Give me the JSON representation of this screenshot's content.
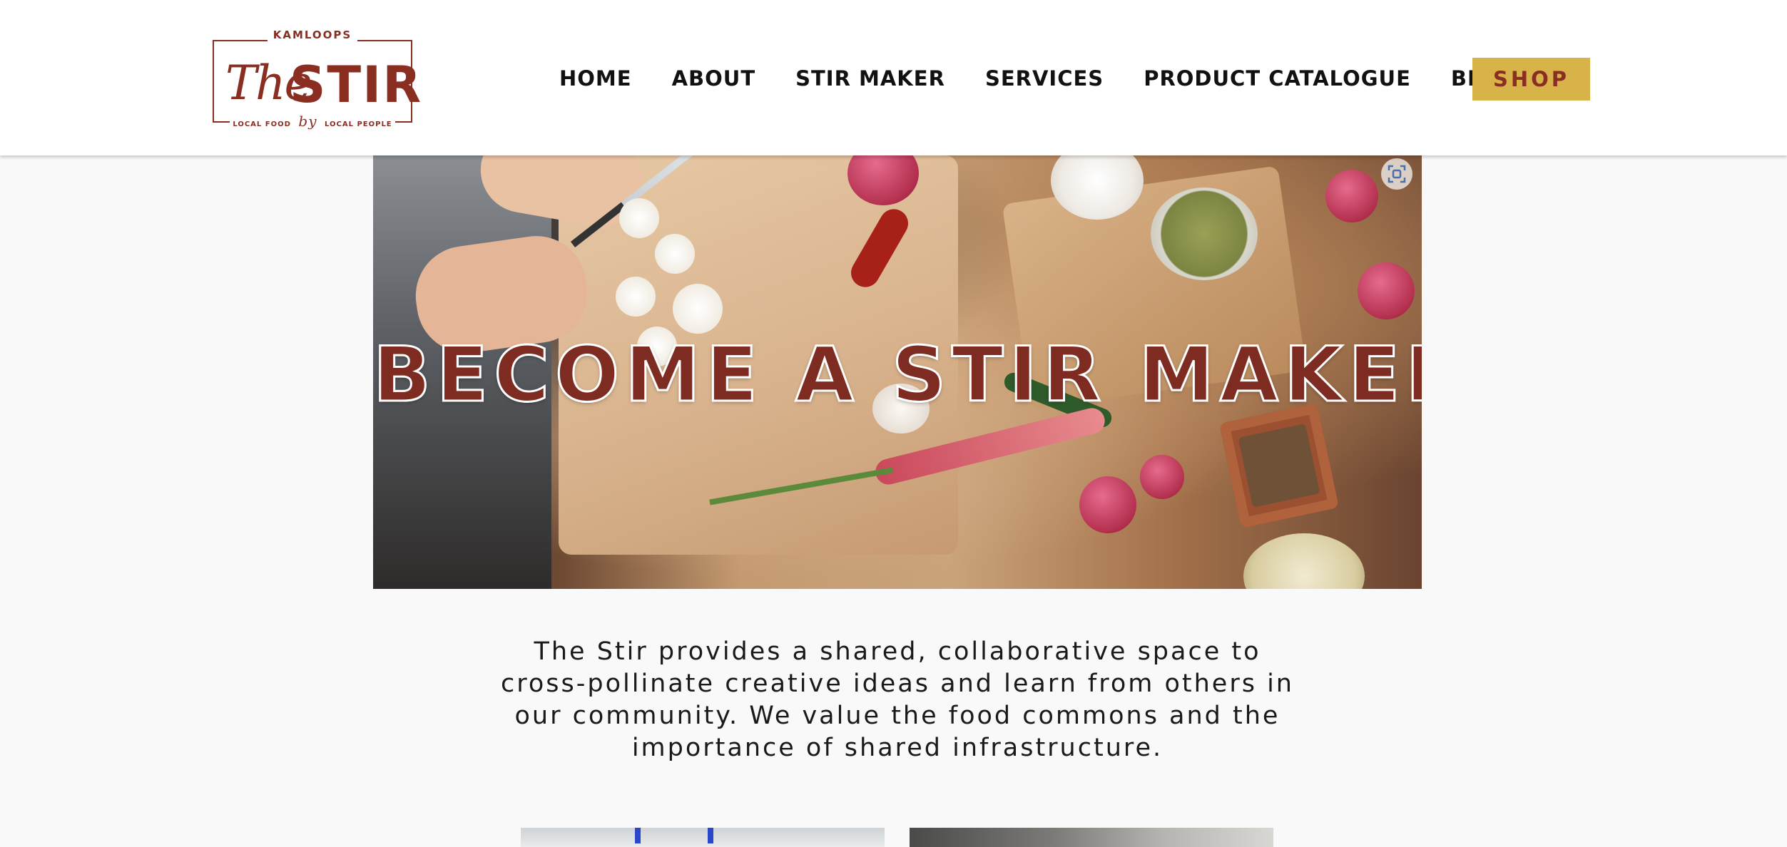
{
  "header": {
    "logo": {
      "top_text": "KAMLOOPS",
      "the": "The",
      "stir": "STIR",
      "tagline_left": "LOCAL FOOD",
      "tagline_by": "by",
      "tagline_right": "LOCAL PEOPLE"
    },
    "nav": [
      {
        "label": "HOME"
      },
      {
        "label": "ABOUT"
      },
      {
        "label": "STIR MAKER"
      },
      {
        "label": "SERVICES"
      },
      {
        "label": "PRODUCT CATALOGUE"
      },
      {
        "label": "BLOG"
      }
    ],
    "shop_label": "SHOP"
  },
  "hero": {
    "title": "BECOME A STIR MAKER",
    "icon": "focus-scan-icon"
  },
  "intro": {
    "text": "The Stir provides a shared, collaborative space to cross-pollinate creative ideas and learn from others in our community. We value the food commons and the importance of shared infrastructure."
  },
  "colors": {
    "brand_red": "#8a2e22",
    "shop_gold": "#d8b34a",
    "hero_title": "#7e2c21",
    "page_bg": "#f9f9f9"
  }
}
